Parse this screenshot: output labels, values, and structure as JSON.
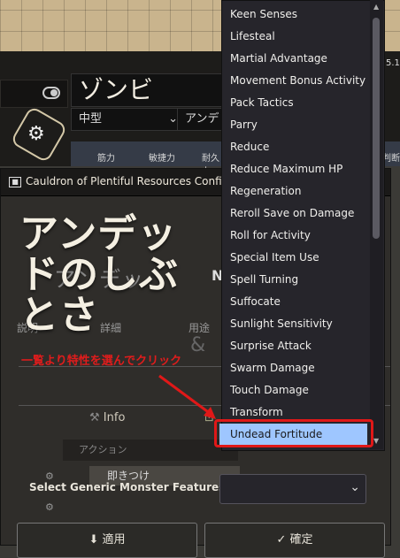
{
  "sheet": {
    "actor_name": "ゾンビ",
    "size_select": "中型",
    "type_select": "アンデ",
    "stat_headers": [
      "筋力",
      "敏捷力",
      "耐久力"
    ],
    "version": "5.1",
    "right_header": "判断力"
  },
  "dialog": {
    "title": "Cauldron of Plentiful Resources Configu",
    "doc_title": "アンデッ",
    "doc_n": "N",
    "section_labels": [
      "説明",
      "詳細",
      "用途",
      "&"
    ],
    "info_tab": "Info",
    "action_row": "アクション",
    "equip_row": "即きつけ",
    "select_label": "Select Generic Monster Features:",
    "apply_button": "適用",
    "confirm_button": "確定"
  },
  "overlay": {
    "big_text": "アンデッドのしぶとさ",
    "annotation": "一覧より特性を選んでクリック"
  },
  "dropdown": {
    "items": [
      "Keen Senses",
      "Lifesteal",
      "Martial Advantage",
      "Movement Bonus Activity",
      "Pack Tactics",
      "Parry",
      "Reduce",
      "Reduce Maximum HP",
      "Regeneration",
      "Reroll Save on Damage",
      "Roll for Activity",
      "Special Item Use",
      "Spell Turning",
      "Suffocate",
      "Sunlight Sensitivity",
      "Surprise Attack",
      "Swarm Damage",
      "Touch Damage",
      "Transform"
    ],
    "selected": "Undead Fortitude"
  },
  "colors": {
    "highlight": "#9ec6ff",
    "annotation_red": "#e01c1c",
    "dialog_bg": "#2f2d2a"
  }
}
